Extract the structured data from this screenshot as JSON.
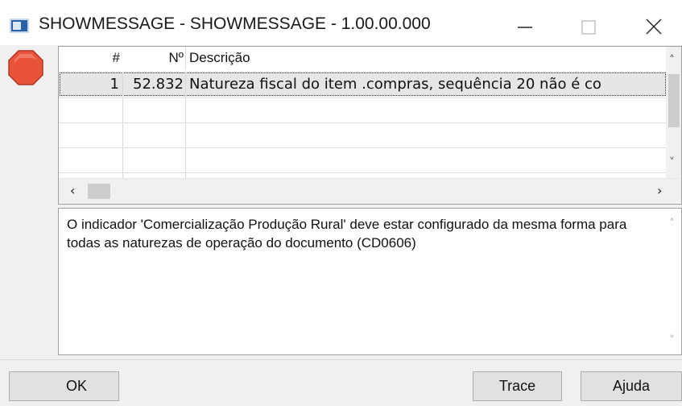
{
  "window": {
    "title": "SHOWMESSAGE - SHOWMESSAGE - 1.00.00.000"
  },
  "grid": {
    "columns": [
      "#",
      "Nº",
      "Descrição"
    ],
    "rows": [
      {
        "idx": "1",
        "num": "52.832",
        "desc": "Natureza fiscal do item .compras, sequência 20 não é co"
      }
    ]
  },
  "message": {
    "text": "O indicador 'Comercialização Produção Rural' deve estar configurado da mesma forma para todas as naturezas de operação do documento (CD0606)"
  },
  "buttons": {
    "ok": "OK",
    "trace": "Trace",
    "help": "Ajuda"
  },
  "colors": {
    "stop_icon": "#e8533a",
    "selection": "#e6e6e6"
  }
}
